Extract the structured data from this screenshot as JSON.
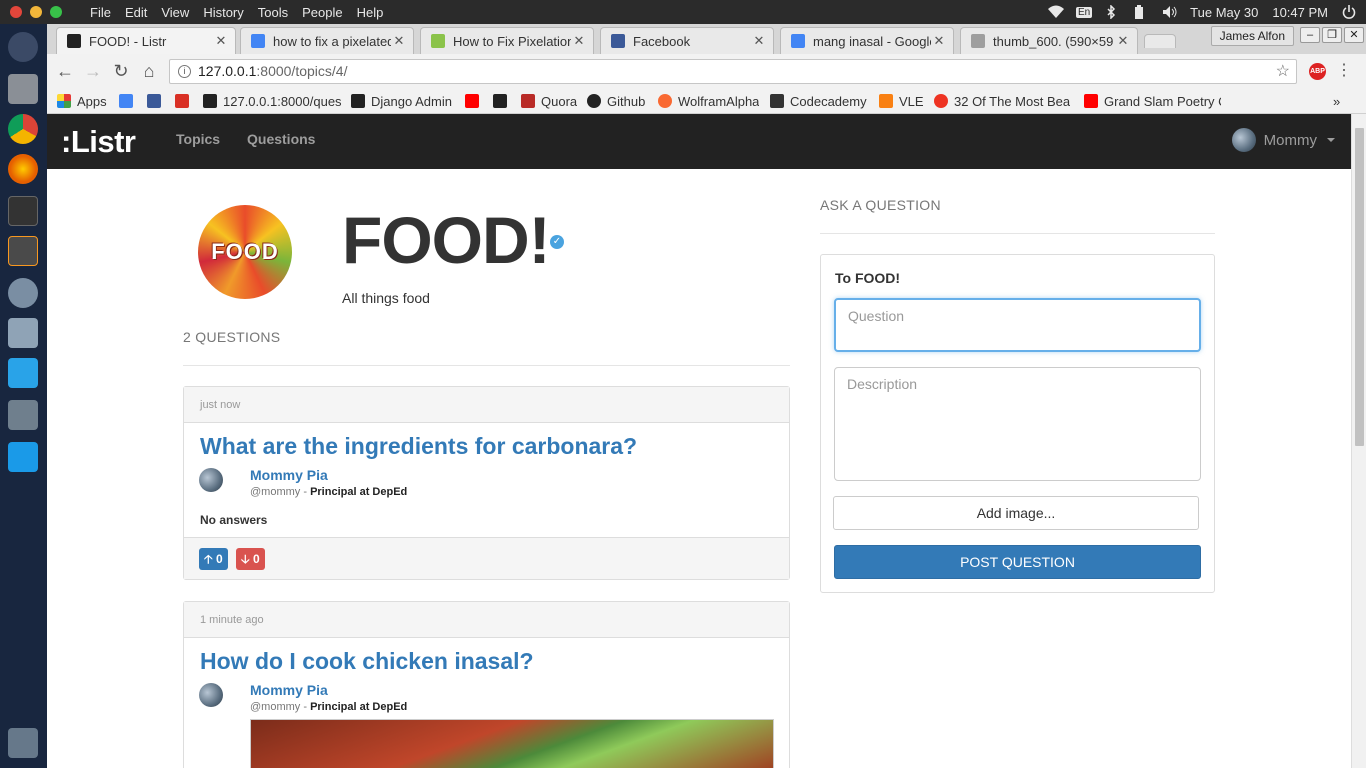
{
  "os": {
    "menu": [
      "File",
      "Edit",
      "View",
      "History",
      "Tools",
      "People",
      "Help"
    ],
    "keyboard": "En",
    "date": "Tue May 30",
    "time": "10:47 PM"
  },
  "browser": {
    "tabs": [
      {
        "title": "FOOD! - Listr",
        "favicon_color": "#222222",
        "active": true
      },
      {
        "title": "how to fix a pixelated",
        "favicon_color": "#4285f4",
        "active": false
      },
      {
        "title": "How to Fix Pixelation",
        "favicon_color": "#8bc34a",
        "active": false
      },
      {
        "title": "Facebook",
        "favicon_color": "#3b5998",
        "active": false
      },
      {
        "title": "mang inasal - Google",
        "favicon_color": "#4285f4",
        "active": false
      },
      {
        "title": "thumb_600. (590×59",
        "favicon_color": "#9e9e9e",
        "active": false
      }
    ],
    "user": "James Alfon",
    "url_host": "127.0.0.1",
    "url_path": ":8000/topics/4/",
    "bookmarks": [
      {
        "label": "Apps",
        "color": "#e53935"
      },
      {
        "label": "",
        "color": "#4285f4"
      },
      {
        "label": "",
        "color": "#3b5998"
      },
      {
        "label": "",
        "color": "#d93025"
      },
      {
        "label": "127.0.0.1:8000/ques",
        "color": "#222222"
      },
      {
        "label": "Django Admin",
        "color": "#222222"
      },
      {
        "label": "",
        "color": "#ff0000"
      },
      {
        "label": "",
        "color": "#222222"
      },
      {
        "label": "Quora",
        "color": "#b92b27"
      },
      {
        "label": "Github",
        "color": "#222222"
      },
      {
        "label": "WolframAlpha",
        "color": "#f96932"
      },
      {
        "label": "Codecademy",
        "color": "#333333"
      },
      {
        "label": "VLE",
        "color": "#f98012"
      },
      {
        "label": "32 Of The Most Bea",
        "color": "#ee3322"
      },
      {
        "label": "Grand Slam Poetry C",
        "color": "#ff0000"
      }
    ]
  },
  "site": {
    "brand": ":Listr",
    "nav": [
      "Topics",
      "Questions"
    ],
    "user": "Mommy"
  },
  "topic": {
    "image_text": "FOOD",
    "title": "FOOD!",
    "description": "All things food",
    "question_count": "2 QUESTIONS"
  },
  "questions": [
    {
      "time": "just now",
      "title": "What are the ingredients for carbonara?",
      "author": "Mommy Pia",
      "handle": "@mommy",
      "role": "Principal at DepEd",
      "answers": "No answers",
      "upvotes": "0",
      "downvotes": "0"
    },
    {
      "time": "1 minute ago",
      "title": "How do I cook chicken inasal?",
      "author": "Mommy Pia",
      "handle": "@mommy",
      "role": "Principal at DepEd"
    }
  ],
  "ask": {
    "heading": "ASK A QUESTION",
    "to": "To FOOD!",
    "question_placeholder": "Question",
    "description_placeholder": "Description",
    "add_image": "Add image...",
    "post": "POST QUESTION"
  },
  "colors": {
    "link": "#337ab7",
    "navbar": "#222222",
    "upvote": "#337ab7",
    "downvote": "#d9534f"
  }
}
